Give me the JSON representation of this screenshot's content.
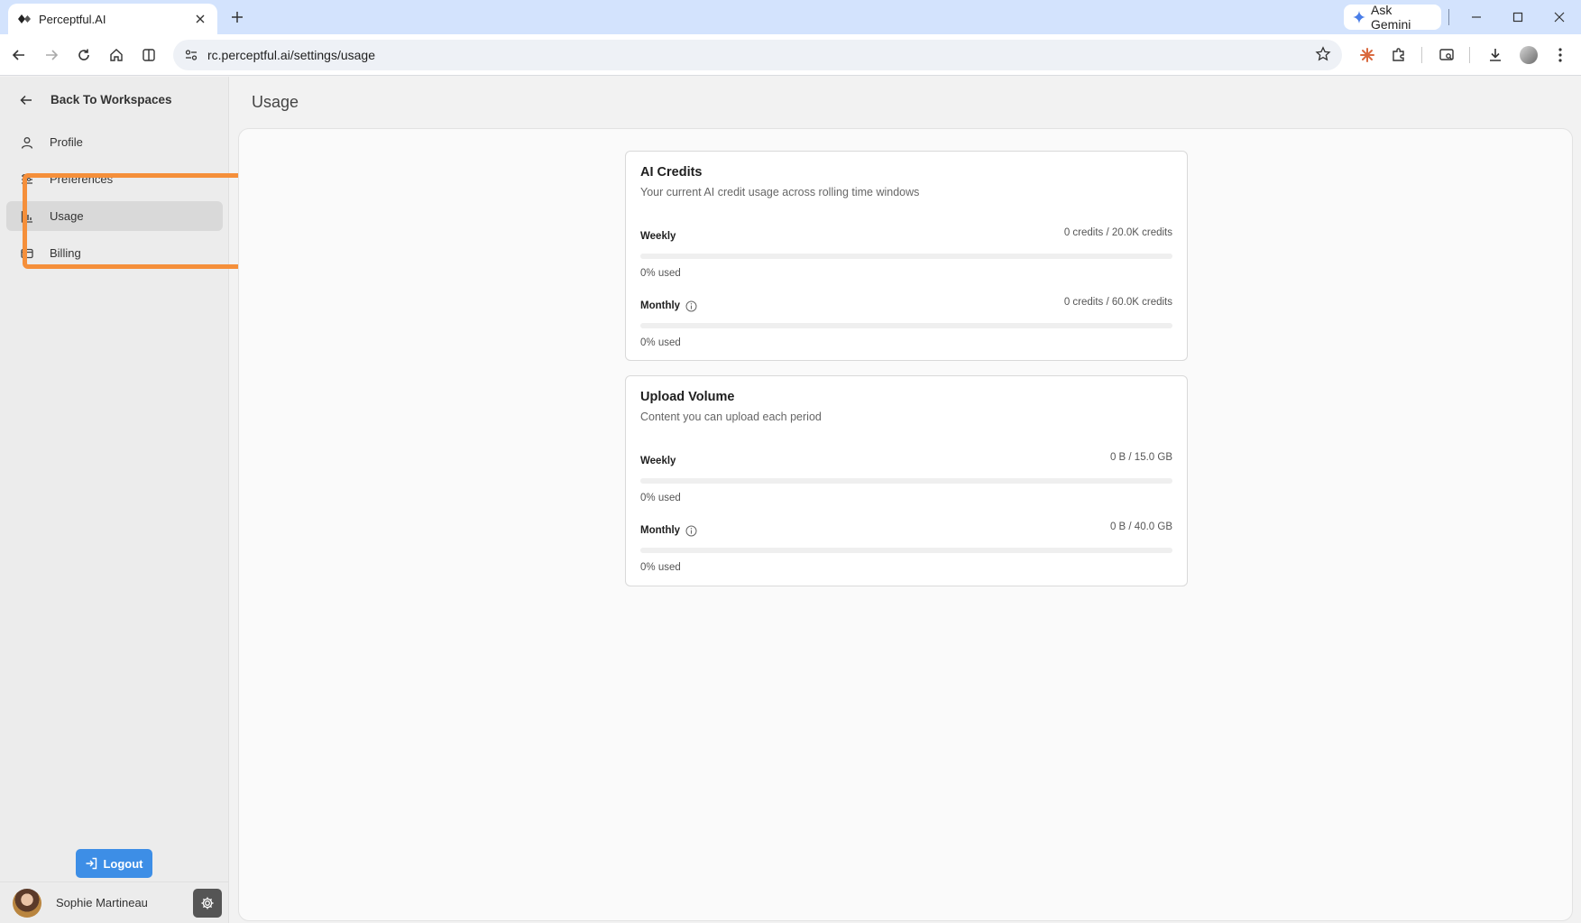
{
  "browser": {
    "tab_title": "Perceptful.AI",
    "url": "rc.perceptful.ai/settings/usage",
    "gemini_label": "Ask Gemini"
  },
  "sidebar": {
    "back_label": "Back To Workspaces",
    "items": [
      {
        "label": "Profile",
        "icon": "user-icon",
        "active": false
      },
      {
        "label": "Preferences",
        "icon": "sliders-icon",
        "active": false
      },
      {
        "label": "Usage",
        "icon": "bar-chart-icon",
        "active": true
      },
      {
        "label": "Billing",
        "icon": "card-icon",
        "active": false
      }
    ],
    "logout_label": "Logout",
    "user_name": "Sophie Martineau"
  },
  "page": {
    "title": "Usage"
  },
  "cards": [
    {
      "title": "AI Credits",
      "subtitle": "Your current AI credit usage across rolling time windows",
      "metrics": [
        {
          "name": "Weekly",
          "value": "0 credits / 20.0K credits",
          "used": "0% used",
          "percent": 0,
          "info": false
        },
        {
          "name": "Monthly",
          "value": "0 credits / 60.0K credits",
          "used": "0% used",
          "percent": 0,
          "info": true
        }
      ]
    },
    {
      "title": "Upload Volume",
      "subtitle": "Content you can upload each period",
      "metrics": [
        {
          "name": "Weekly",
          "value": "0 B / 15.0 GB",
          "used": "0% used",
          "percent": 0,
          "info": false
        },
        {
          "name": "Monthly",
          "value": "0 B / 40.0 GB",
          "used": "0% used",
          "percent": 0,
          "info": true
        }
      ]
    }
  ],
  "colors": {
    "accent": "#3d8ee6",
    "highlight": "#f58f3a",
    "tabstrip": "#d3e3fd"
  }
}
